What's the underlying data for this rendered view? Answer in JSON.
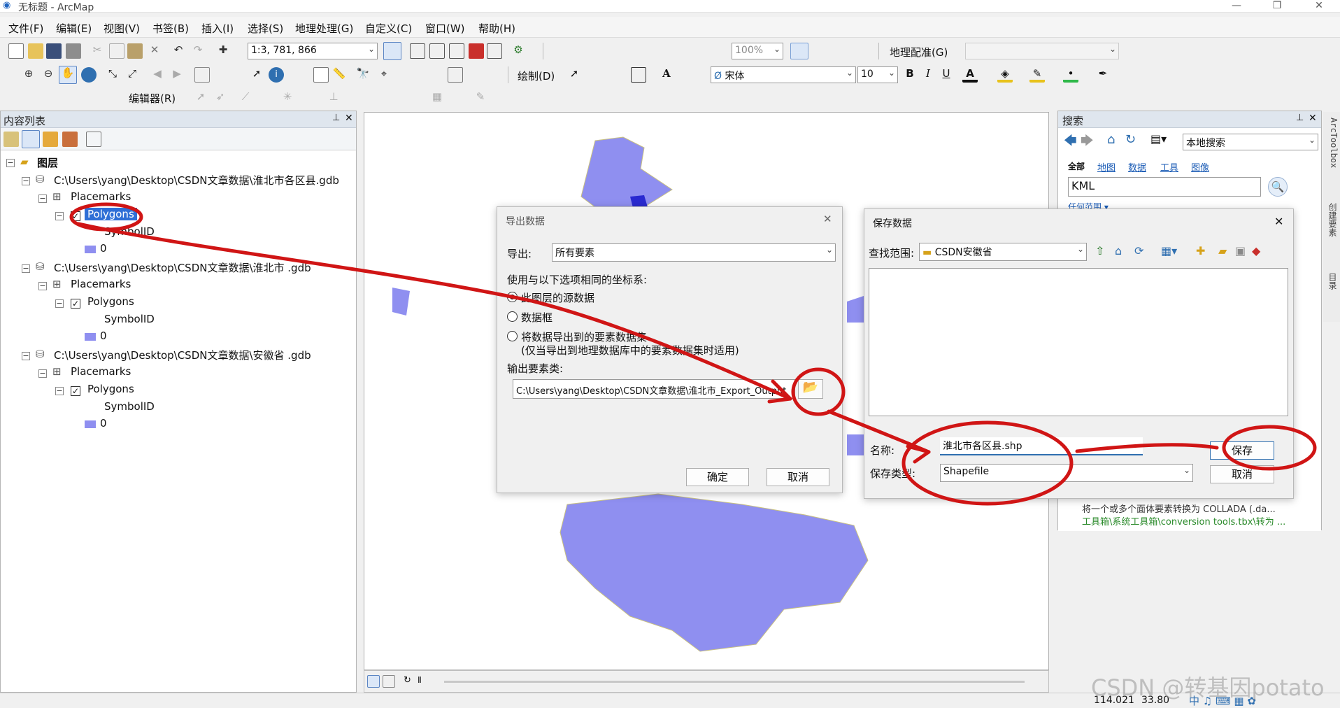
{
  "window": {
    "title": "无标题 - ArcMap"
  },
  "menu": [
    "文件(F)",
    "编辑(E)",
    "视图(V)",
    "书签(B)",
    "插入(I)",
    "选择(S)",
    "地理处理(G)",
    "自定义(C)",
    "窗口(W)",
    "帮助(H)"
  ],
  "toolbar": {
    "scale": "1:3, 781, 866",
    "zoom": "100%",
    "georef": "地理配准(G)",
    "draw": "绘制(D)",
    "font": "宋体",
    "font_size": "10",
    "editor": "编辑器(R)"
  },
  "toc": {
    "title": "内容列表",
    "root": "图层",
    "groups": [
      {
        "path": "C:\\Users\\yang\\Desktop\\CSDN文章数据\\淮北市各区县.gdb",
        "folder": "Placemarks",
        "layer": "Polygons",
        "field": "SymbolID",
        "value": "0"
      },
      {
        "path": "C:\\Users\\yang\\Desktop\\CSDN文章数据\\淮北市 .gdb",
        "folder": "Placemarks",
        "layer": "Polygons",
        "field": "SymbolID",
        "value": "0"
      },
      {
        "path": "C:\\Users\\yang\\Desktop\\CSDN文章数据\\安徽省 .gdb",
        "folder": "Placemarks",
        "layer": "Polygons",
        "field": "SymbolID",
        "value": "0"
      }
    ]
  },
  "export_dialog": {
    "title": "导出数据",
    "export_label": "导出:",
    "export_value": "所有要素",
    "coord_label": "使用与以下选项相同的坐标系:",
    "options": [
      "此图层的源数据",
      "数据框",
      "将数据导出到的要素数据集"
    ],
    "option_note": "(仅当导出到地理数据库中的要素数据集时适用)",
    "output_label": "输出要素类:",
    "output_path": "C:\\Users\\yang\\Desktop\\CSDN文章数据\\淮北市_Export_Output",
    "ok": "确定",
    "cancel": "取消"
  },
  "save_dialog": {
    "title": "保存数据",
    "look_in_label": "查找范围:",
    "look_in_value": "CSDN安徽省",
    "name_label": "名称:",
    "name_value": "淮北市各区县.shp",
    "type_label": "保存类型:",
    "type_value": "Shapefile",
    "save": "保存",
    "cancel": "取消"
  },
  "search": {
    "title": "搜索",
    "scope": "本地搜索",
    "tabs": [
      "全部",
      "地图",
      "数据",
      "工具",
      "图像"
    ],
    "query": "KML",
    "range": "任何范围",
    "result_desc": "将一个或多个面体要素转换为 COLLADA (.da...",
    "result_path": "工具箱\\系统工具箱\\conversion tools.tbx\\转为 ..."
  },
  "side_tabs": [
    "ArcToolbox",
    "创建要素",
    "目录"
  ],
  "status": {
    "x": "114.021",
    "y": "33.80"
  },
  "watermark": "CSDN @转基因potato",
  "colors": {
    "polygon": "#8f8ff0",
    "annotation": "#d01515",
    "selection": "#2f6fd6"
  }
}
